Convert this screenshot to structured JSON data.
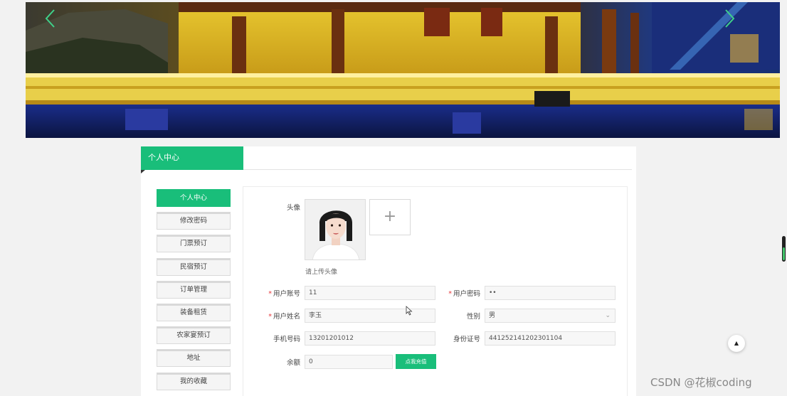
{
  "banner": {
    "prev_icon": "chevron-left-icon",
    "next_icon": "chevron-right-icon"
  },
  "panel": {
    "title": "个人中心"
  },
  "menu": [
    {
      "label": "个人中心",
      "active": true
    },
    {
      "label": "修改密码"
    },
    {
      "label": "门票预订"
    },
    {
      "label": "民宿预订"
    },
    {
      "label": "订单管理"
    },
    {
      "label": "装备租赁"
    },
    {
      "label": "农家宴预订"
    },
    {
      "label": "地址"
    },
    {
      "label": "我的收藏"
    }
  ],
  "form": {
    "avatar_label": "头像",
    "upload_icon": "+",
    "upload_hint": "请上传头像",
    "account_label": "用户账号",
    "account_value": "11",
    "password_label": "用户密码",
    "password_value": "••",
    "name_label": "用户姓名",
    "name_value": "李玉",
    "gender_label": "性别",
    "gender_value": "男",
    "phone_label": "手机号码",
    "phone_value": "13201201012",
    "id_label": "身份证号",
    "id_value": "441252141202301104",
    "balance_label": "余额",
    "balance_value": "0",
    "recharge_label": "点我充值",
    "required_mark": "*",
    "select_arrow": "⌄"
  },
  "back_to_top": "▲",
  "watermark": "CSDN @花椒coding",
  "colors": {
    "accent": "#19be7a",
    "required": "#e6393d"
  }
}
